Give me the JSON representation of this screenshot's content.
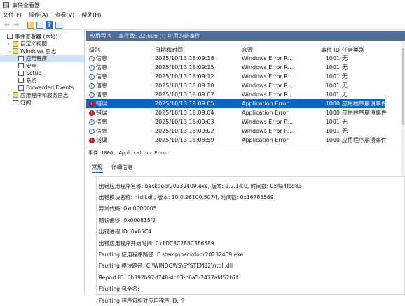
{
  "window": {
    "title": "事件查看器"
  },
  "menu": [
    "文件(F)",
    "操作(A)",
    "查看(V)",
    "帮助(H)"
  ],
  "toolbar": {
    "back": "⇦",
    "forward": "⇨",
    "help": "?"
  },
  "tree": [
    {
      "label": "事件查看器 (本地)",
      "icon": "log-icon",
      "indent": 0,
      "chev": ""
    },
    {
      "label": "自定义视图",
      "icon": "folder-icon",
      "indent": 1,
      "chev": "›"
    },
    {
      "label": "Windows 日志",
      "icon": "folder-icon",
      "indent": 1,
      "chev": "⌄"
    },
    {
      "label": "应用程序",
      "icon": "log-icon",
      "indent": 2,
      "chev": "",
      "selected": true
    },
    {
      "label": "安全",
      "icon": "log-icon",
      "indent": 2,
      "chev": ""
    },
    {
      "label": "Setup",
      "icon": "log-icon",
      "indent": 2,
      "chev": ""
    },
    {
      "label": "系统",
      "icon": "log-icon",
      "indent": 2,
      "chev": ""
    },
    {
      "label": "Forwarded Events",
      "icon": "log-icon",
      "indent": 2,
      "chev": ""
    },
    {
      "label": "应用程序和服务日志",
      "icon": "folder-icon",
      "indent": 1,
      "chev": "›"
    },
    {
      "label": "订阅",
      "icon": "log-icon",
      "indent": 1,
      "chev": ""
    }
  ],
  "panel": {
    "title": "应用程序",
    "count": "事件数: 22,606 (!) 可用的新事件"
  },
  "columns": {
    "level": "级别",
    "date": "日期和时间",
    "source": "来源",
    "id": "事件 ID",
    "task": "任务类别"
  },
  "events": [
    {
      "level": "信息",
      "type": "info",
      "date": "2025/10/13 18:09:18",
      "source": "Windows Error R...",
      "id": "1001",
      "task": "无"
    },
    {
      "level": "信息",
      "type": "info",
      "date": "2025/10/13 18:09:15",
      "source": "Windows Error R...",
      "id": "1001",
      "task": "无"
    },
    {
      "level": "信息",
      "type": "info",
      "date": "2025/10/13 18:09:12",
      "source": "Windows Error R...",
      "id": "1001",
      "task": "无"
    },
    {
      "level": "信息",
      "type": "info",
      "date": "2025/10/13 18:09:10",
      "source": "Windows Error R...",
      "id": "1001",
      "task": "无"
    },
    {
      "level": "信息",
      "type": "info",
      "date": "2025/10/13 18:09:07",
      "source": "Windows Error R...",
      "id": "1001",
      "task": "无"
    },
    {
      "level": "错误",
      "type": "error",
      "date": "2025/10/13 18:09:05",
      "source": "Application Error",
      "id": "1000",
      "task": "应用程序崩溃事件",
      "selected": true
    },
    {
      "level": "错误",
      "type": "error",
      "date": "2025/10/13 18:09:04",
      "source": "Application Error",
      "id": "1000",
      "task": "应用程序崩溃事件"
    },
    {
      "level": "信息",
      "type": "info",
      "date": "2025/10/13 18:09:03",
      "source": "Windows Error R...",
      "id": "1001",
      "task": "无"
    },
    {
      "level": "信息",
      "type": "info",
      "date": "2025/10/13 18:09:02",
      "source": "Windows Error R...",
      "id": "1001",
      "task": "无"
    },
    {
      "level": "错误",
      "type": "error",
      "date": "2025/10/13 18:08:59",
      "source": "Application Error",
      "id": "1000",
      "task": "应用程序崩溃事件"
    }
  ],
  "event_title": "事件 1000, Application Error",
  "tabs": [
    "常规",
    "详细信息"
  ],
  "details": [
    "出错应用程序名称: backdoor20232409.exe, 版本: 2.2.14.0, 时间戳: 0x4a4fcd83",
    "出错模块名称: ntdll.dll, 版本: 10.0.26100.5074, 时间戳: 0x16785569",
    "异常代码: 0xc0000005",
    "错误偏移: 0x000815f2",
    "出错进程 ID: 0x65C4",
    "出错应用程序开始时间: 0x1DC3C288C3F6589",
    "Faulting 应用程序路径: D:\\temp\\backdoor20232409.exe",
    "Faulting 模块路径: C:\\WINDOWS\\SYSTEM32\\ntdll.dll",
    "Report ID: 6b392b97-f748-4c63-b6a5-2477afd52b7f",
    "Faulting 包全名:",
    "Faulting 程序包相对应用程序 ID: 个"
  ]
}
